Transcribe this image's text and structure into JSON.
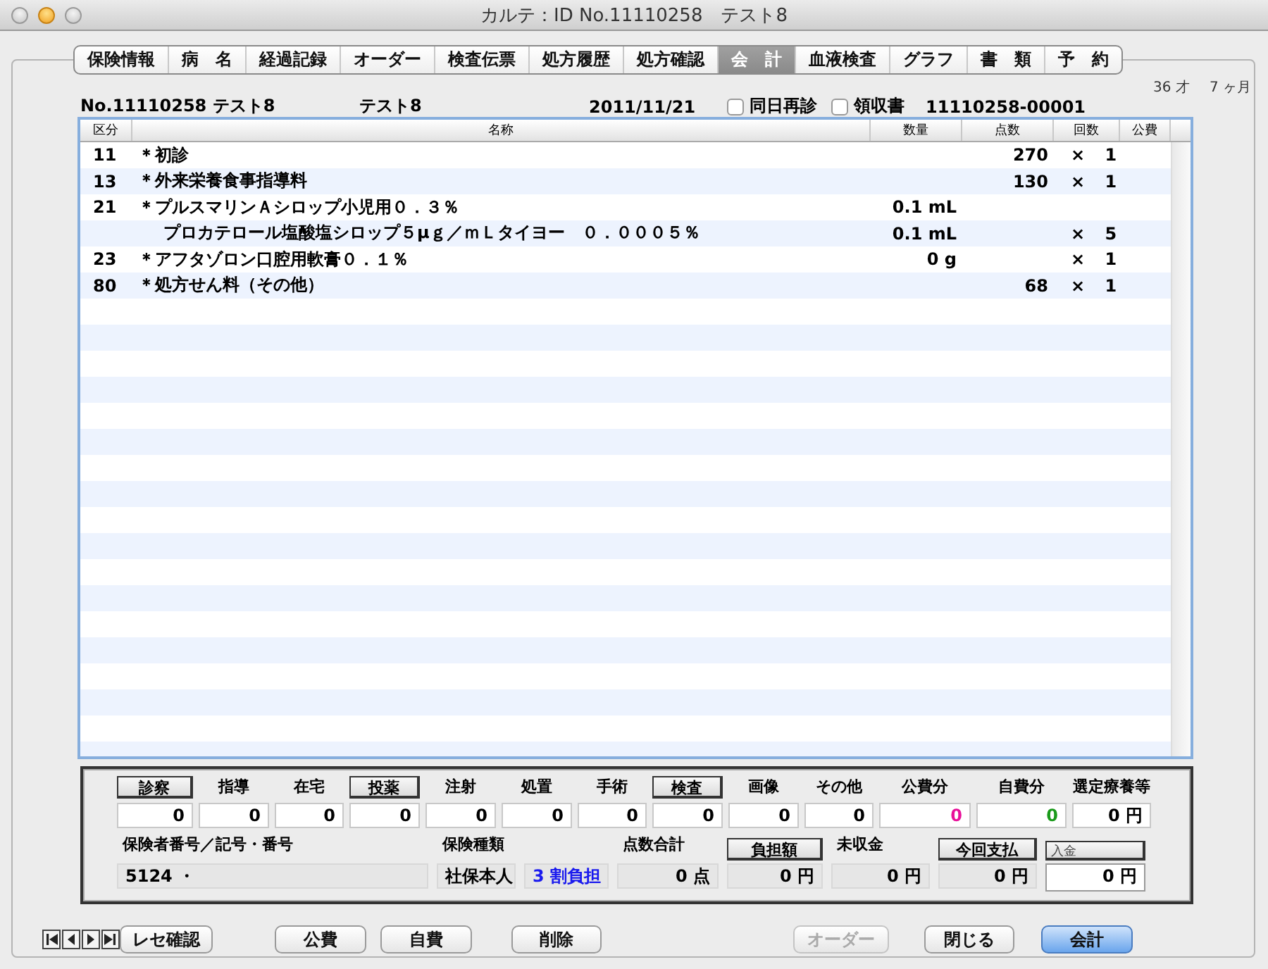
{
  "window": {
    "title": "カルテ：ID No.11110258　テスト8"
  },
  "tabs": [
    {
      "label": "保険情報",
      "selected": false
    },
    {
      "label": "病　名",
      "selected": false
    },
    {
      "label": "経過記録",
      "selected": false
    },
    {
      "label": "オーダー",
      "selected": false
    },
    {
      "label": "検査伝票",
      "selected": false
    },
    {
      "label": "処方履歴",
      "selected": false
    },
    {
      "label": "処方確認",
      "selected": false
    },
    {
      "label": "会　計",
      "selected": true
    },
    {
      "label": "血液検査",
      "selected": false
    },
    {
      "label": "グラフ",
      "selected": false
    },
    {
      "label": "書　類",
      "selected": false
    },
    {
      "label": "予　約",
      "selected": false
    }
  ],
  "age": {
    "years": "36 才",
    "months": "7 ヶ月"
  },
  "header": {
    "patient": "No.11110258 テスト8",
    "name": "テスト8",
    "date": "2011/11/21",
    "checkboxes": [
      {
        "label": "同日再診",
        "checked": false
      },
      {
        "label": "領収書",
        "checked": false
      }
    ],
    "receipt_no": "11110258-00001"
  },
  "table": {
    "columns": [
      "区分",
      "名称",
      "数量",
      "点数",
      "回数",
      "公費"
    ],
    "rows": [
      {
        "category": "11",
        "name": "＊初診",
        "points": "270",
        "times": "× 1"
      },
      {
        "category": "13",
        "name": "＊外来栄養食事指導料",
        "points": "130",
        "times": "× 1"
      },
      {
        "category": "21",
        "name": "＊プルスマリンＡシロップ小児用０．３％",
        "quantity": "0.1 mL",
        "children": [
          {
            "name": "プロカテロール塩酸塩シロップ５μｇ／ｍＬタイヨー　０．０００５％",
            "quantity": "0.1 mL",
            "times": "× 5"
          }
        ]
      },
      {
        "category": "23",
        "name": "＊アフタゾロン口腔用軟膏０．１％",
        "quantity": "0 g",
        "times": "× 1"
      },
      {
        "category": "80",
        "name": "＊処方せん料（その他）",
        "points": "68",
        "times": "× 1"
      }
    ]
  },
  "categories": [
    {
      "label": "診察",
      "kind": "button",
      "value": "0",
      "color": "#000000"
    },
    {
      "label": "指導",
      "kind": "label",
      "value": "0",
      "color": "#000000"
    },
    {
      "label": "在宅",
      "kind": "label",
      "value": "0",
      "color": "#000000"
    },
    {
      "label": "投薬",
      "kind": "button",
      "value": "0",
      "color": "#000000"
    },
    {
      "label": "注射",
      "kind": "label",
      "value": "0",
      "color": "#000000"
    },
    {
      "label": "処置",
      "kind": "label",
      "value": "0",
      "color": "#000000"
    },
    {
      "label": "手術",
      "kind": "label",
      "value": "0",
      "color": "#000000"
    },
    {
      "label": "検査",
      "kind": "button",
      "value": "0",
      "color": "#000000"
    },
    {
      "label": "画像",
      "kind": "label",
      "value": "0",
      "color": "#000000"
    },
    {
      "label": "その他",
      "kind": "label",
      "value": "0",
      "color": "#000000"
    },
    {
      "label": "公費分",
      "kind": "label",
      "value": "0",
      "color": "#e8109a"
    },
    {
      "label": "自費分",
      "kind": "label",
      "value": "0",
      "color": "#1a9a1a"
    },
    {
      "label": "選定療養等",
      "kind": "label",
      "value": "0 円",
      "color": "#000000"
    }
  ],
  "summary": [
    {
      "label": "保険者番号／記号・番号",
      "kind": "label",
      "values": [
        {
          "text": "5124 ・",
          "kind": "text",
          "color": "#000000"
        }
      ]
    },
    {
      "label": "保険種類",
      "kind": "label",
      "values": [
        {
          "text": "社保本人",
          "kind": "tag",
          "color": "#000000"
        },
        {
          "text": "3 割負担",
          "kind": "tag",
          "color": "#1a1aee"
        }
      ]
    },
    {
      "label": "点数合計",
      "kind": "label",
      "values": [
        {
          "text": "0 点",
          "kind": "amount",
          "color": "#000000"
        }
      ]
    },
    {
      "label": "負担額",
      "kind": "button",
      "values": [
        {
          "text": "0 円",
          "kind": "amount",
          "color": "#000000"
        }
      ]
    },
    {
      "label": "未収金",
      "kind": "label",
      "values": [
        {
          "text": "0 円",
          "kind": "amount",
          "color": "#000000"
        }
      ]
    },
    {
      "label": "今回支払",
      "kind": "button",
      "values": [
        {
          "text": "0 円",
          "kind": "amount",
          "color": "#000000"
        }
      ]
    },
    {
      "label": "入金",
      "kind": "small_button",
      "values": [
        {
          "text": "0 円",
          "kind": "input",
          "color": "#000000"
        }
      ]
    }
  ],
  "buttons": [
    {
      "label": "レセ確認",
      "kind": "normal"
    },
    {
      "label": "公費",
      "kind": "normal"
    },
    {
      "label": "自費",
      "kind": "normal"
    },
    {
      "label": "削除",
      "kind": "normal"
    },
    {
      "label": "オーダー",
      "kind": "disabled"
    },
    {
      "label": "閉じる",
      "kind": "normal"
    },
    {
      "label": "会計",
      "kind": "default"
    }
  ]
}
